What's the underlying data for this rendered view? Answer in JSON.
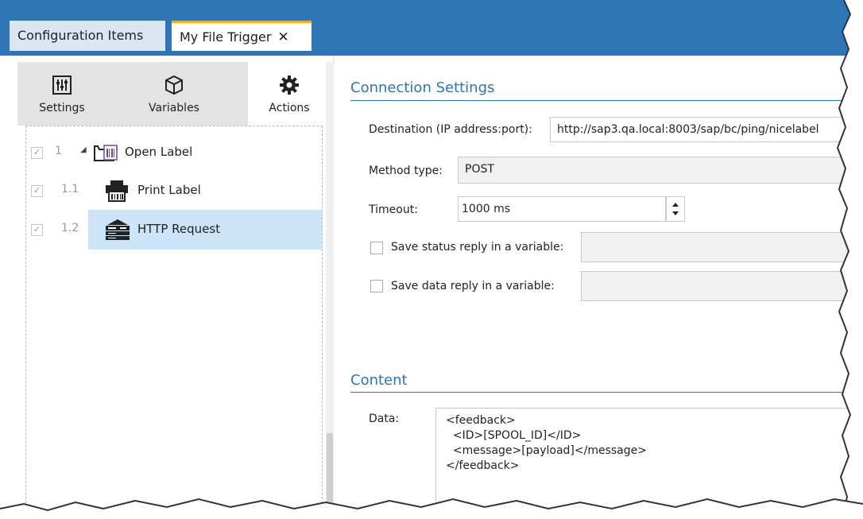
{
  "tabs": {
    "config_label": "Configuration Items",
    "trigger_label": "My File Trigger",
    "close_glyph": "✕"
  },
  "left_tabs": [
    {
      "label": "Settings",
      "icon": "sliders-icon"
    },
    {
      "label": "Variables",
      "icon": "cube-icon"
    },
    {
      "label": "Actions",
      "icon": "gear-icon"
    }
  ],
  "tree": [
    {
      "checked": true,
      "number": "1",
      "expander": "◢",
      "icon": "open-label-icon",
      "label": "Open Label"
    },
    {
      "checked": true,
      "number": "1.1",
      "icon": "printer-icon",
      "label": "Print Label"
    },
    {
      "checked": true,
      "number": "1.2",
      "icon": "server-icon",
      "label": "HTTP Request",
      "selected": true
    }
  ],
  "connection": {
    "heading": "Connection Settings",
    "destination_label": "Destination (IP address:port):",
    "destination_value": "http://sap3.qa.local:8003/sap/bc/ping/nicelabel",
    "method_label": "Method type:",
    "method_value": "POST",
    "timeout_label": "Timeout:",
    "timeout_value": "1000 ms",
    "save_status_label": "Save status reply in a variable:",
    "save_data_label": "Save data reply in a variable:"
  },
  "content": {
    "heading": "Content",
    "data_label": "Data:",
    "data_lines": [
      "<feedback>",
      "  <ID>[SPOOL_ID]</ID>",
      "  <message>[payload]</message>",
      "</feedback>"
    ]
  },
  "colors": {
    "accent": "#2e75b6",
    "tab_highlight": "#f2b01e",
    "selection": "#cce4f7"
  }
}
